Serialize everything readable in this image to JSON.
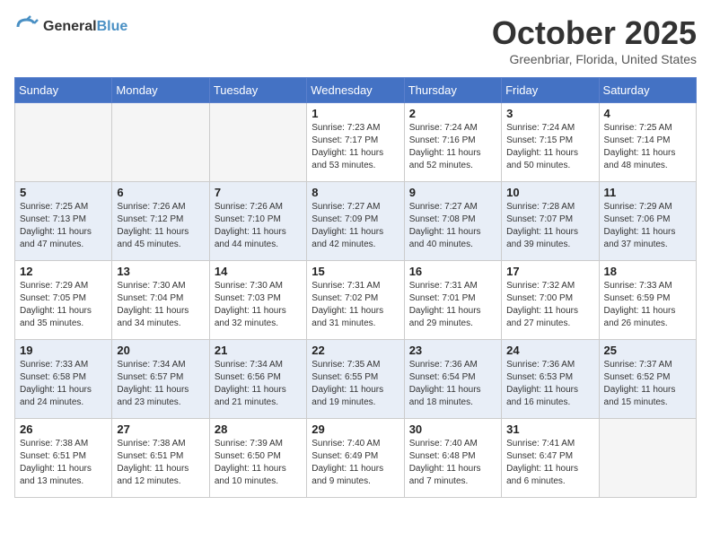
{
  "header": {
    "logo_line1": "General",
    "logo_line2": "Blue",
    "month_title": "October 2025",
    "location": "Greenbriar, Florida, United States"
  },
  "days_of_week": [
    "Sunday",
    "Monday",
    "Tuesday",
    "Wednesday",
    "Thursday",
    "Friday",
    "Saturday"
  ],
  "weeks": [
    [
      {
        "day": "",
        "sunrise": "",
        "sunset": "",
        "daylight": ""
      },
      {
        "day": "",
        "sunrise": "",
        "sunset": "",
        "daylight": ""
      },
      {
        "day": "",
        "sunrise": "",
        "sunset": "",
        "daylight": ""
      },
      {
        "day": "1",
        "sunrise": "Sunrise: 7:23 AM",
        "sunset": "Sunset: 7:17 PM",
        "daylight": "Daylight: 11 hours and 53 minutes."
      },
      {
        "day": "2",
        "sunrise": "Sunrise: 7:24 AM",
        "sunset": "Sunset: 7:16 PM",
        "daylight": "Daylight: 11 hours and 52 minutes."
      },
      {
        "day": "3",
        "sunrise": "Sunrise: 7:24 AM",
        "sunset": "Sunset: 7:15 PM",
        "daylight": "Daylight: 11 hours and 50 minutes."
      },
      {
        "day": "4",
        "sunrise": "Sunrise: 7:25 AM",
        "sunset": "Sunset: 7:14 PM",
        "daylight": "Daylight: 11 hours and 48 minutes."
      }
    ],
    [
      {
        "day": "5",
        "sunrise": "Sunrise: 7:25 AM",
        "sunset": "Sunset: 7:13 PM",
        "daylight": "Daylight: 11 hours and 47 minutes."
      },
      {
        "day": "6",
        "sunrise": "Sunrise: 7:26 AM",
        "sunset": "Sunset: 7:12 PM",
        "daylight": "Daylight: 11 hours and 45 minutes."
      },
      {
        "day": "7",
        "sunrise": "Sunrise: 7:26 AM",
        "sunset": "Sunset: 7:10 PM",
        "daylight": "Daylight: 11 hours and 44 minutes."
      },
      {
        "day": "8",
        "sunrise": "Sunrise: 7:27 AM",
        "sunset": "Sunset: 7:09 PM",
        "daylight": "Daylight: 11 hours and 42 minutes."
      },
      {
        "day": "9",
        "sunrise": "Sunrise: 7:27 AM",
        "sunset": "Sunset: 7:08 PM",
        "daylight": "Daylight: 11 hours and 40 minutes."
      },
      {
        "day": "10",
        "sunrise": "Sunrise: 7:28 AM",
        "sunset": "Sunset: 7:07 PM",
        "daylight": "Daylight: 11 hours and 39 minutes."
      },
      {
        "day": "11",
        "sunrise": "Sunrise: 7:29 AM",
        "sunset": "Sunset: 7:06 PM",
        "daylight": "Daylight: 11 hours and 37 minutes."
      }
    ],
    [
      {
        "day": "12",
        "sunrise": "Sunrise: 7:29 AM",
        "sunset": "Sunset: 7:05 PM",
        "daylight": "Daylight: 11 hours and 35 minutes."
      },
      {
        "day": "13",
        "sunrise": "Sunrise: 7:30 AM",
        "sunset": "Sunset: 7:04 PM",
        "daylight": "Daylight: 11 hours and 34 minutes."
      },
      {
        "day": "14",
        "sunrise": "Sunrise: 7:30 AM",
        "sunset": "Sunset: 7:03 PM",
        "daylight": "Daylight: 11 hours and 32 minutes."
      },
      {
        "day": "15",
        "sunrise": "Sunrise: 7:31 AM",
        "sunset": "Sunset: 7:02 PM",
        "daylight": "Daylight: 11 hours and 31 minutes."
      },
      {
        "day": "16",
        "sunrise": "Sunrise: 7:31 AM",
        "sunset": "Sunset: 7:01 PM",
        "daylight": "Daylight: 11 hours and 29 minutes."
      },
      {
        "day": "17",
        "sunrise": "Sunrise: 7:32 AM",
        "sunset": "Sunset: 7:00 PM",
        "daylight": "Daylight: 11 hours and 27 minutes."
      },
      {
        "day": "18",
        "sunrise": "Sunrise: 7:33 AM",
        "sunset": "Sunset: 6:59 PM",
        "daylight": "Daylight: 11 hours and 26 minutes."
      }
    ],
    [
      {
        "day": "19",
        "sunrise": "Sunrise: 7:33 AM",
        "sunset": "Sunset: 6:58 PM",
        "daylight": "Daylight: 11 hours and 24 minutes."
      },
      {
        "day": "20",
        "sunrise": "Sunrise: 7:34 AM",
        "sunset": "Sunset: 6:57 PM",
        "daylight": "Daylight: 11 hours and 23 minutes."
      },
      {
        "day": "21",
        "sunrise": "Sunrise: 7:34 AM",
        "sunset": "Sunset: 6:56 PM",
        "daylight": "Daylight: 11 hours and 21 minutes."
      },
      {
        "day": "22",
        "sunrise": "Sunrise: 7:35 AM",
        "sunset": "Sunset: 6:55 PM",
        "daylight": "Daylight: 11 hours and 19 minutes."
      },
      {
        "day": "23",
        "sunrise": "Sunrise: 7:36 AM",
        "sunset": "Sunset: 6:54 PM",
        "daylight": "Daylight: 11 hours and 18 minutes."
      },
      {
        "day": "24",
        "sunrise": "Sunrise: 7:36 AM",
        "sunset": "Sunset: 6:53 PM",
        "daylight": "Daylight: 11 hours and 16 minutes."
      },
      {
        "day": "25",
        "sunrise": "Sunrise: 7:37 AM",
        "sunset": "Sunset: 6:52 PM",
        "daylight": "Daylight: 11 hours and 15 minutes."
      }
    ],
    [
      {
        "day": "26",
        "sunrise": "Sunrise: 7:38 AM",
        "sunset": "Sunset: 6:51 PM",
        "daylight": "Daylight: 11 hours and 13 minutes."
      },
      {
        "day": "27",
        "sunrise": "Sunrise: 7:38 AM",
        "sunset": "Sunset: 6:51 PM",
        "daylight": "Daylight: 11 hours and 12 minutes."
      },
      {
        "day": "28",
        "sunrise": "Sunrise: 7:39 AM",
        "sunset": "Sunset: 6:50 PM",
        "daylight": "Daylight: 11 hours and 10 minutes."
      },
      {
        "day": "29",
        "sunrise": "Sunrise: 7:40 AM",
        "sunset": "Sunset: 6:49 PM",
        "daylight": "Daylight: 11 hours and 9 minutes."
      },
      {
        "day": "30",
        "sunrise": "Sunrise: 7:40 AM",
        "sunset": "Sunset: 6:48 PM",
        "daylight": "Daylight: 11 hours and 7 minutes."
      },
      {
        "day": "31",
        "sunrise": "Sunrise: 7:41 AM",
        "sunset": "Sunset: 6:47 PM",
        "daylight": "Daylight: 11 hours and 6 minutes."
      },
      {
        "day": "",
        "sunrise": "",
        "sunset": "",
        "daylight": ""
      }
    ]
  ]
}
